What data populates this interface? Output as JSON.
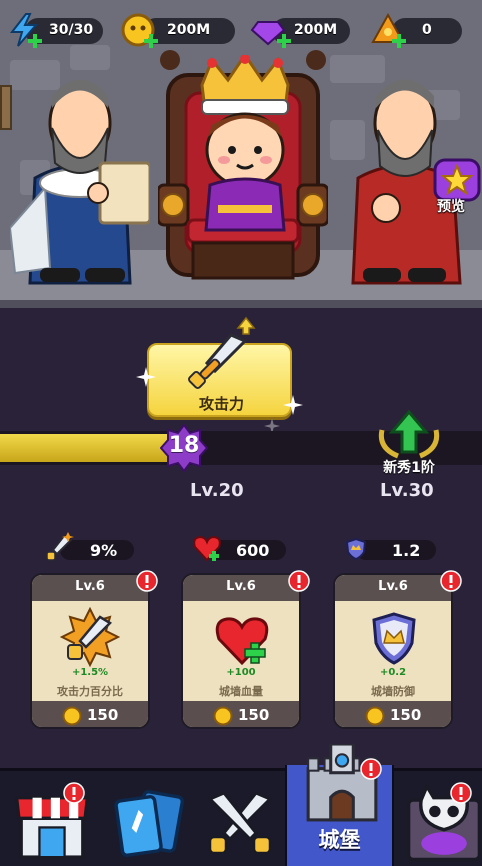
{
  "resources": [
    {
      "name": "energy",
      "value": "30/30",
      "icon": "lightning-icon",
      "color": "#3fa6f0"
    },
    {
      "name": "gold",
      "value": "200M",
      "icon": "coin-icon",
      "color": "#f7c420"
    },
    {
      "name": "gems",
      "value": "200M",
      "icon": "gem-icon",
      "color": "#a347e8"
    },
    {
      "name": "tickets",
      "value": "0",
      "icon": "ticket-icon",
      "color": "#f29a1a"
    }
  ],
  "preview": {
    "label": "预览"
  },
  "upgrade": {
    "title": "攻击力",
    "level": "18",
    "progress": 0.35,
    "current_level": "Lv.20",
    "next_level": "Lv.30",
    "next_rank": "新秀1阶"
  },
  "stats": [
    {
      "name": "attack-percent",
      "value": "9%",
      "icon": "sword-icon"
    },
    {
      "name": "wall-hp",
      "value": "600",
      "icon": "heart-icon"
    },
    {
      "name": "wall-defense",
      "value": "1.2",
      "icon": "shield-icon"
    }
  ],
  "cards": [
    {
      "name": "attack-percent",
      "level": "Lv.6",
      "gain": "+1.5%",
      "label": "攻击力百分比",
      "cost": "150",
      "icon": "sword-icon"
    },
    {
      "name": "wall-hp",
      "level": "Lv.6",
      "gain": "+100",
      "label": "城墙血量",
      "cost": "150",
      "icon": "heart-icon"
    },
    {
      "name": "wall-defense",
      "level": "Lv.6",
      "gain": "+0.2",
      "label": "城墙防御",
      "cost": "150",
      "icon": "shield-icon"
    }
  ],
  "nav": {
    "items": [
      {
        "name": "shop",
        "icon": "shop-icon",
        "alert": true
      },
      {
        "name": "cards",
        "icon": "card-icon",
        "alert": false
      },
      {
        "name": "battle",
        "icon": "crossed-swords-icon",
        "alert": false
      },
      {
        "name": "castle",
        "icon": "castle-icon",
        "alert": true,
        "label": "城堡"
      },
      {
        "name": "skull",
        "icon": "skull-icon",
        "alert": true
      }
    ]
  },
  "colors": {
    "accent": "#4257c9",
    "progress": "#e6c52e",
    "alert": "#e8262e",
    "background": "#2a2238"
  }
}
